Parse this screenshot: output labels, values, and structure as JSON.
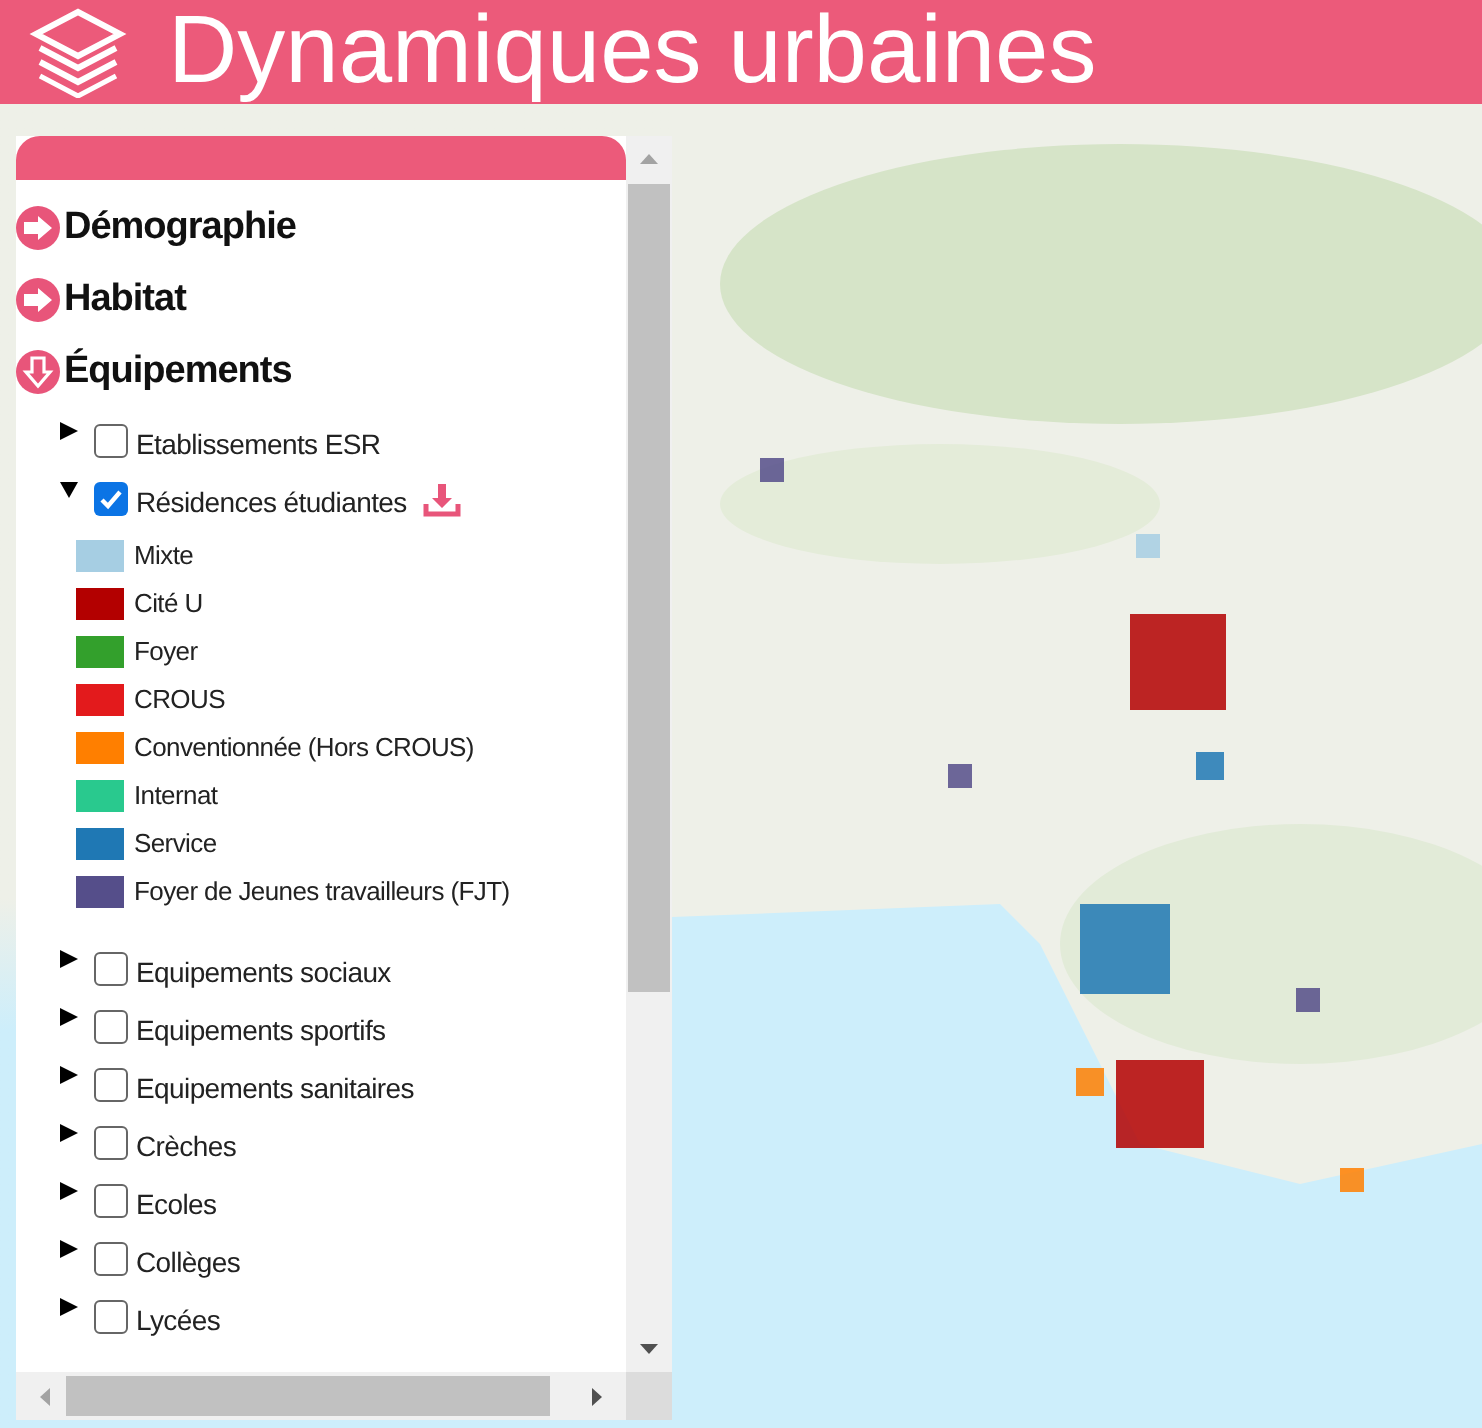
{
  "header": {
    "title": "Dynamiques urbaines"
  },
  "sections": [
    {
      "title": "Démographie",
      "expanded": false
    },
    {
      "title": "Habitat",
      "expanded": false
    },
    {
      "title": "Équipements",
      "expanded": true,
      "layers": [
        {
          "label": "Etablissements ESR",
          "expanded": false,
          "checked": false
        },
        {
          "label": "Résidences étudiantes",
          "expanded": true,
          "checked": true,
          "legend": [
            {
              "label": "Mixte",
              "color": "#a6cee3"
            },
            {
              "label": "Cité U",
              "color": "#b30000"
            },
            {
              "label": "Foyer",
              "color": "#33a02c"
            },
            {
              "label": "CROUS",
              "color": "#e31a1c"
            },
            {
              "label": "Conventionnée (Hors CROUS)",
              "color": "#ff7f00"
            },
            {
              "label": "Internat",
              "color": "#29c98e"
            },
            {
              "label": "Service",
              "color": "#1f78b4"
            },
            {
              "label": "Foyer de Jeunes travailleurs (FJT)",
              "color": "#554e8a"
            }
          ]
        },
        {
          "label": "Equipements sociaux",
          "expanded": false,
          "checked": false
        },
        {
          "label": "Equipements sportifs",
          "expanded": false,
          "checked": false
        },
        {
          "label": "Equipements sanitaires",
          "expanded": false,
          "checked": false
        },
        {
          "label": "Crèches",
          "expanded": false,
          "checked": false
        },
        {
          "label": "Ecoles",
          "expanded": false,
          "checked": false
        },
        {
          "label": "Collèges",
          "expanded": false,
          "checked": false
        },
        {
          "label": "Lycées",
          "expanded": false,
          "checked": false
        }
      ]
    }
  ]
}
